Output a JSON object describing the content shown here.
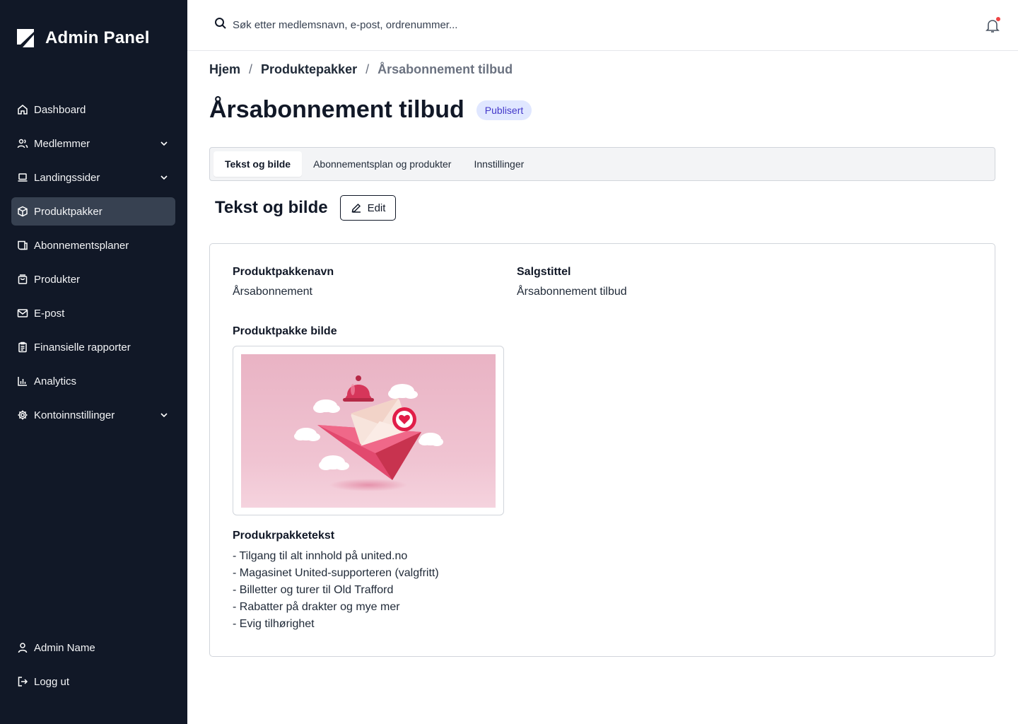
{
  "app": {
    "title": "Admin Panel"
  },
  "sidebar": {
    "items": [
      {
        "label": "Dashboard",
        "icon": "home-icon",
        "expandable": false,
        "active": false
      },
      {
        "label": "Medlemmer",
        "icon": "users-icon",
        "expandable": true,
        "active": false
      },
      {
        "label": "Landingssider",
        "icon": "laptop-icon",
        "expandable": true,
        "active": false
      },
      {
        "label": "Produktpakker",
        "icon": "package-icon",
        "expandable": false,
        "active": true
      },
      {
        "label": "Abonnementsplaner",
        "icon": "subscription-icon",
        "expandable": false,
        "active": false
      },
      {
        "label": "Produkter",
        "icon": "shopping-bag-icon",
        "expandable": false,
        "active": false
      },
      {
        "label": "E-post",
        "icon": "mail-icon",
        "expandable": false,
        "active": false
      },
      {
        "label": "Finansielle rapporter",
        "icon": "clipboard-icon",
        "expandable": false,
        "active": false
      },
      {
        "label": "Analytics",
        "icon": "bar-chart-icon",
        "expandable": false,
        "active": false
      },
      {
        "label": "Kontoinnstillinger",
        "icon": "gear-icon",
        "expandable": true,
        "active": false
      }
    ],
    "bottom": [
      {
        "label": "Admin Name",
        "icon": "user-icon"
      },
      {
        "label": "Logg ut",
        "icon": "logout-icon"
      }
    ]
  },
  "search": {
    "placeholder": "Søk etter medlemsnavn, e-post, ordrenummer..."
  },
  "breadcrumb": {
    "home": "Hjem",
    "parent": "Produktepakker",
    "current": "Årsabonnement tilbud",
    "separator": "/"
  },
  "page": {
    "title": "Årsabonnement tilbud",
    "status": "Publisert"
  },
  "tabs": [
    {
      "label": "Tekst og bilde",
      "active": true
    },
    {
      "label": "Abonnementsplan og produkter",
      "active": false
    },
    {
      "label": "Innstillinger",
      "active": false
    }
  ],
  "section": {
    "title": "Tekst og bilde",
    "edit_label": "Edit"
  },
  "details": {
    "name_label": "Produktpakkenavn",
    "name_value": "Årsabonnement",
    "sales_title_label": "Salgstittel",
    "sales_title_value": "Årsabonnement tilbud",
    "image_label": "Produktpakke bilde",
    "text_label": "Produkrpakketekst",
    "text_lines": [
      "- Tilgang til alt innhold på united.no",
      "- Magasinet United-supporteren (valgfritt)",
      "- Billetter og turer til Old Trafford",
      "- Rabatter på drakter og mye mer",
      "- Evig tilhørighet"
    ]
  },
  "colors": {
    "sidebar_bg": "#111827",
    "sidebar_active": "#374151",
    "badge_bg": "#e0e7ff",
    "badge_text": "#4338ca",
    "notification_dot": "#ef4444"
  }
}
